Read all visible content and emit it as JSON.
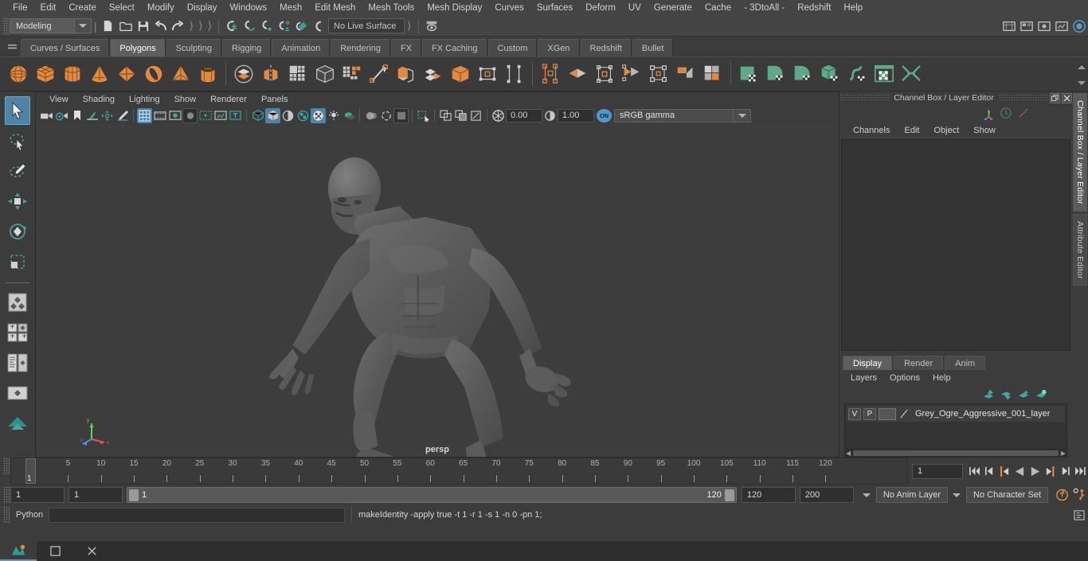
{
  "menubar": {
    "items": [
      "File",
      "Edit",
      "Create",
      "Select",
      "Modify",
      "Display",
      "Windows",
      "Mesh",
      "Edit Mesh",
      "Mesh Tools",
      "Mesh Display",
      "Curves",
      "Surfaces",
      "Deform",
      "UV",
      "Generate",
      "Cache",
      "- 3DtoAll -",
      "Redshift",
      "Help"
    ]
  },
  "statusline": {
    "menuset": "Modeling",
    "live_surface": "No Live Surface",
    "icons": [
      "new-scene-icon",
      "open-scene-icon",
      "save-scene-icon",
      "undo-icon",
      "redo-icon",
      "select-by-hierarchy-icon",
      "select-by-object-icon",
      "select-by-component-icon",
      "snap-to-grid-icon",
      "snap-to-curve-icon",
      "snap-to-point-icon",
      "snap-to-projected-center-icon",
      "snap-to-view-plane-icon",
      "make-live-icon",
      "show-hide-editors-icon",
      "render-view-icon",
      "render-sequence-icon",
      "ipr-render-icon",
      "render-settings-icon",
      "hypershade-icon"
    ]
  },
  "shelf": {
    "tabs": [
      "Curves / Surfaces",
      "Polygons",
      "Sculpting",
      "Rigging",
      "Animation",
      "Rendering",
      "FX",
      "FX Caching",
      "Custom",
      "XGen",
      "Redshift",
      "Bullet"
    ],
    "active_tab": "Polygons",
    "icons": [
      "poly-sphere-icon",
      "poly-cube-icon",
      "poly-cylinder-icon",
      "poly-cone-icon",
      "poly-plane-icon",
      "poly-torus-icon",
      "poly-pyramid-icon",
      "poly-pipe-icon",
      "combine-icon",
      "separate-icon",
      "booleans-icon",
      "smooth-icon",
      "mirror-icon",
      "bevel-icon",
      "extrude-icon",
      "multi-cut-icon",
      "target-weld-icon",
      "quad-draw-icon",
      "sculpt-icon",
      "crease-icon",
      "uv-editor-icon",
      "planar-mapping-icon",
      "spherical-mapping-icon",
      "cylindrical-mapping-icon",
      "automatic-mapping-icon",
      "camera-based-mapping-icon",
      "unfold-uv-icon",
      "uv-layout-icon",
      "uv-snapshot-icon",
      "cut-uv-edges-icon"
    ]
  },
  "lefttools": {
    "items": [
      "select-tool-icon",
      "lasso-select-tool-icon",
      "paint-select-tool-icon",
      "move-tool-icon",
      "rotate-tool-icon",
      "scale-tool-icon",
      "last-tool-used-icon",
      "snap-layout-icon",
      "four-view-layout-icon",
      "outliner-persp-layout-icon",
      "persp-graph-layout-icon",
      "hypershade-persp-layout-icon"
    ],
    "active": "select-tool-icon"
  },
  "viewport": {
    "menus": [
      "View",
      "Shading",
      "Lighting",
      "Show",
      "Renderer",
      "Panels"
    ],
    "camera_label": "persp",
    "exposure": "0.00",
    "gamma": "1.00",
    "view_transform_toggle": "ON",
    "view_transform": "sRGB gamma",
    "toolbar_icons": [
      "select-camera-icon",
      "camera-attributes-icon",
      "bookmark-icon",
      "image-plane-icon",
      "two-d-pan-zoom-icon",
      "grease-pencil-icon",
      "grid-icon",
      "film-gate-icon",
      "resolution-gate-icon",
      "gate-mask-icon",
      "film-origin-icon",
      "exposure-icon",
      "xray-icon",
      "wireframe-icon",
      "smooth-shade-icon",
      "shaded-wireframe-icon",
      "textured-icon",
      "use-all-lights-icon",
      "shadows-icon",
      "screen-space-ao-icon",
      "motion-blur-icon",
      "multisample-aa-icon",
      "depth-of-field-icon",
      "isolate-select-icon",
      "xray-joints-icon",
      "xray-active-components-icon",
      "viewport-renderer-icon"
    ]
  },
  "channelbox": {
    "title": "Channel Box / Layer Editor",
    "menus": [
      "Channels",
      "Edit",
      "Object",
      "Show"
    ],
    "header_icons": [
      "axis-gizmo-icon",
      "channel-speed-icon",
      "channel-slider-icon"
    ],
    "window_buttons": [
      "undock-icon",
      "close-icon"
    ]
  },
  "layereditor": {
    "tabs": [
      "Display",
      "Render",
      "Anim"
    ],
    "active_tab": "Display",
    "menus": [
      "Layers",
      "Options",
      "Help"
    ],
    "buttons": [
      "move-layer-up-icon",
      "move-layer-down-icon",
      "new-layer-icon",
      "new-layer-from-selected-icon"
    ],
    "layers": [
      {
        "visibility": "V",
        "playback": "P",
        "color_swatch": "",
        "name": "Grey_Ogre_Aggressive_001_layer"
      }
    ]
  },
  "vtabs": {
    "items": [
      "Channel Box / Layer Editor",
      "Attribute Editor"
    ],
    "active": "Channel Box / Layer Editor"
  },
  "timeline": {
    "ticks": [
      5,
      10,
      15,
      20,
      25,
      30,
      35,
      40,
      45,
      50,
      55,
      60,
      65,
      70,
      75,
      80,
      85,
      90,
      95,
      100,
      105,
      110,
      115,
      120
    ],
    "current_frame": "1",
    "frame_input": "1",
    "playback_buttons": [
      "go-to-start-icon",
      "step-back-frame-icon",
      "step-back-key-icon",
      "play-backwards-icon",
      "play-forwards-icon",
      "step-forward-key-icon",
      "step-forward-frame-icon",
      "go-to-end-icon"
    ]
  },
  "rangeslider": {
    "anim_start": "1",
    "range_start": "1",
    "range_bar_start": "1",
    "range_bar_end": "120",
    "range_end": "120",
    "anim_end": "200",
    "anim_layer": "No Anim Layer",
    "character_set": "No Character Set",
    "icons": [
      "auto-key-icon",
      "animation-preferences-icon"
    ]
  },
  "commandline": {
    "language": "Python",
    "input_value": "",
    "feedback": "makeIdentity -apply true -t 1 -r 1 -s 1 -n 0 -pn 1;",
    "script_editor_icon": "script-editor-icon"
  },
  "taskbar": {
    "buttons": [
      "maya-app-icon",
      "window-icon",
      "close-icon"
    ]
  },
  "colors": {
    "accent_blue": "#4f83a8",
    "shelf_orange": "#e08a42",
    "shelf_green": "#5fa98a",
    "snap_teal": "#3fa9a0",
    "panel_bg": "#3c3c3c",
    "field_bg": "#2f2f2f"
  }
}
